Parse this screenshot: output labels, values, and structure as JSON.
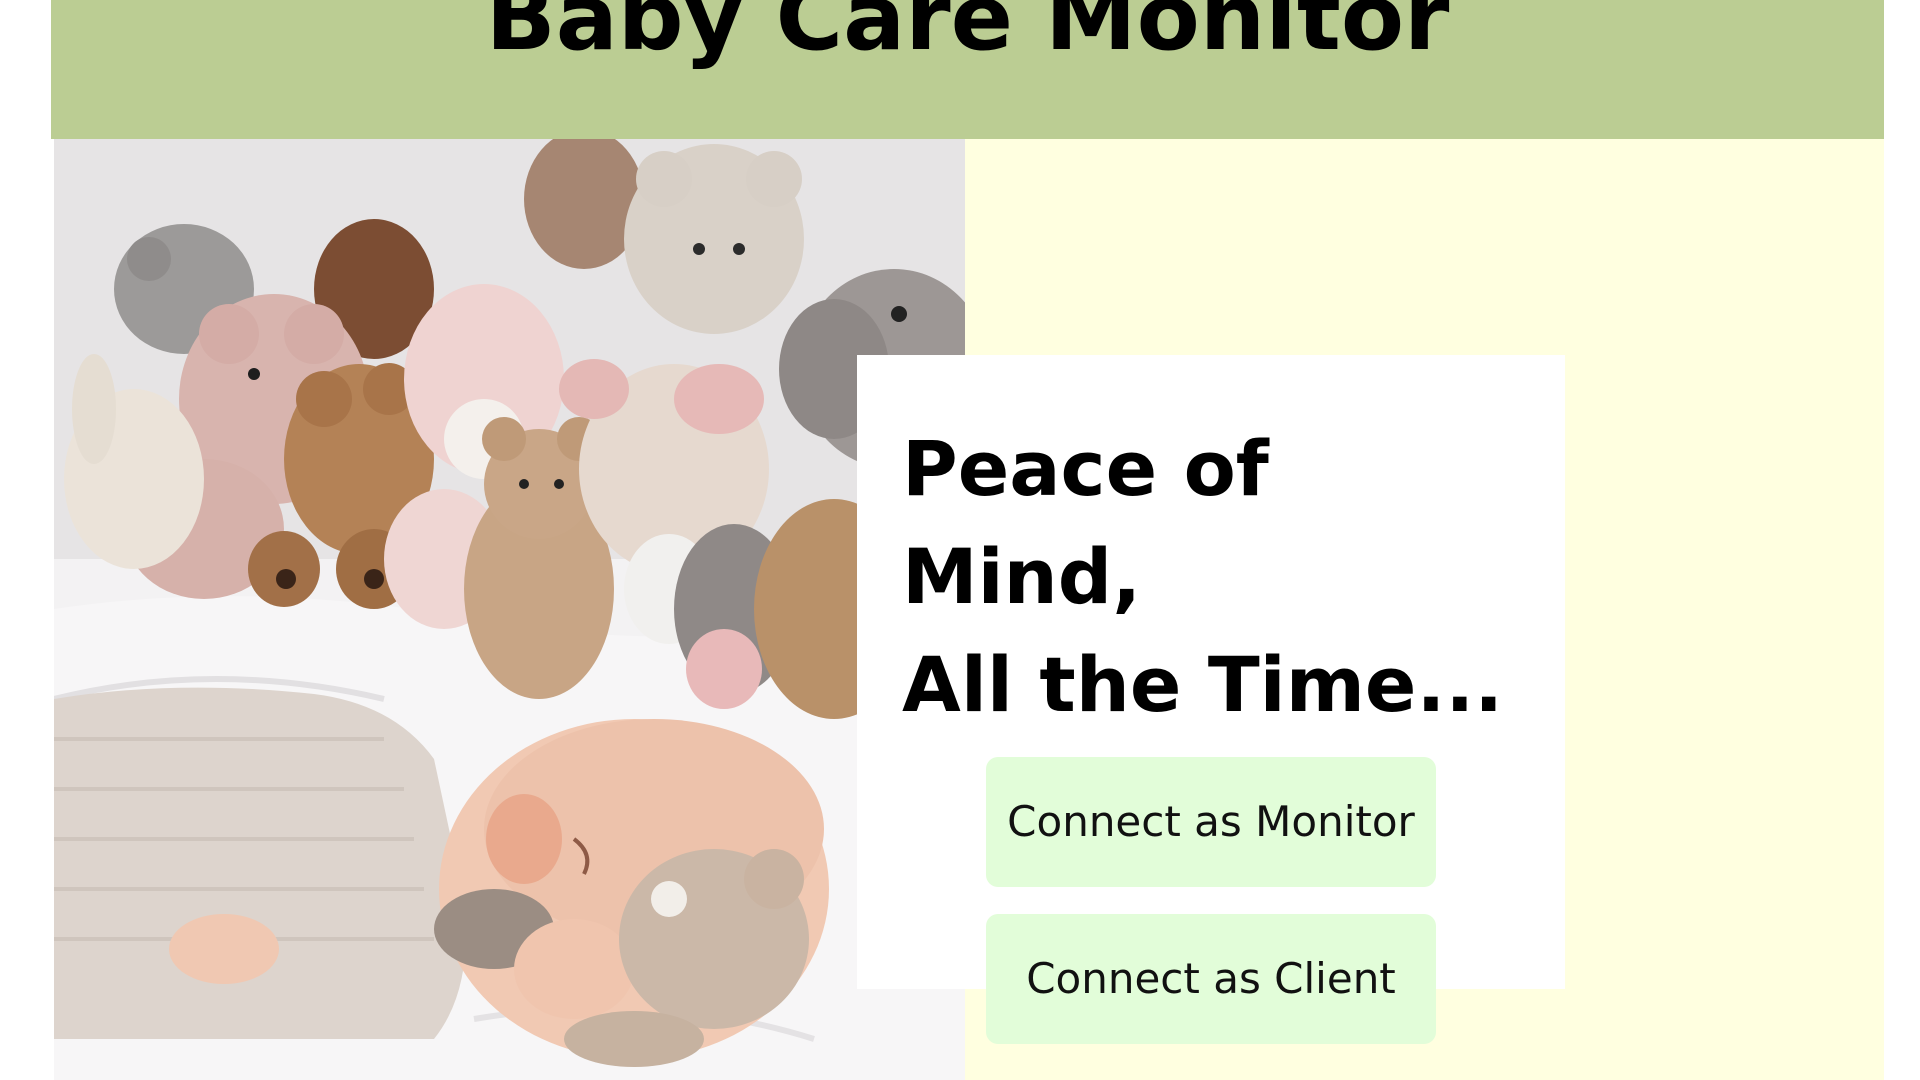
{
  "header": {
    "title": "Baby Care Monitor"
  },
  "hero": {
    "heading_lines": [
      "Peace of",
      "Mind,",
      "All the Time..."
    ]
  },
  "actions": {
    "monitor_label": "Connect as Monitor",
    "client_label": "Connect as Client"
  },
  "colors": {
    "header_bg": "#bbcd93",
    "panel_bg": "#ffffe0",
    "card_bg": "#ffffff",
    "button_bg": "#e2fdd9"
  }
}
